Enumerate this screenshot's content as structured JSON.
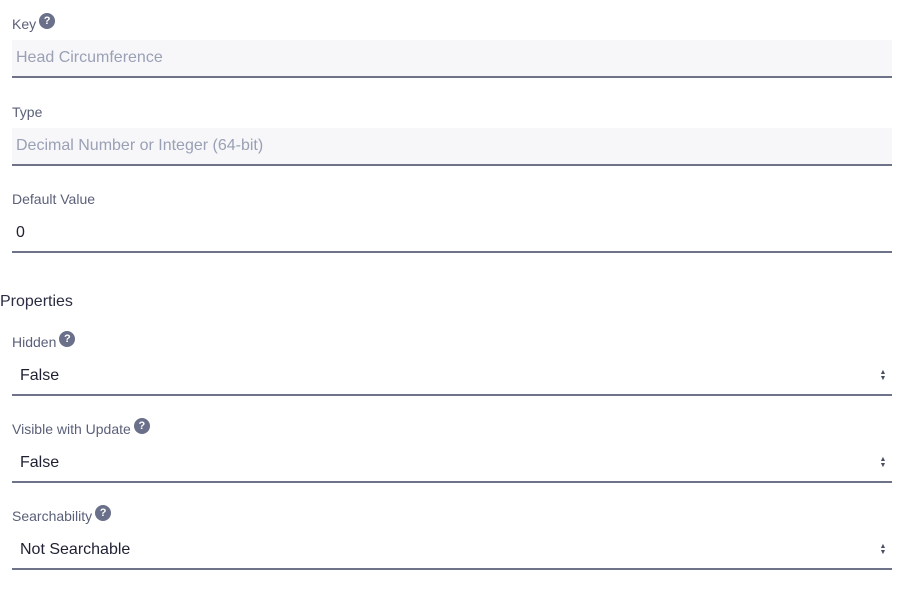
{
  "fields": {
    "key": {
      "label": "Key",
      "value": "Head Circumference"
    },
    "type": {
      "label": "Type",
      "value": "Decimal Number or Integer (64-bit)"
    },
    "default_value": {
      "label": "Default Value",
      "value": "0"
    }
  },
  "properties": {
    "title": "Properties",
    "hidden": {
      "label": "Hidden",
      "selected": "False"
    },
    "visible_with_update": {
      "label": "Visible with Update",
      "selected": "False"
    },
    "searchability": {
      "label": "Searchability",
      "selected": "Not Searchable"
    }
  },
  "icons": {
    "help": "question-circle-icon",
    "select_arrows": "sort-arrows-icon"
  },
  "colors": {
    "label": "#5b6079",
    "underline": "#6e7389",
    "disabled_bg": "#f7f7f9",
    "disabled_text": "#9aa0b5",
    "help_icon": "#6b708a"
  }
}
